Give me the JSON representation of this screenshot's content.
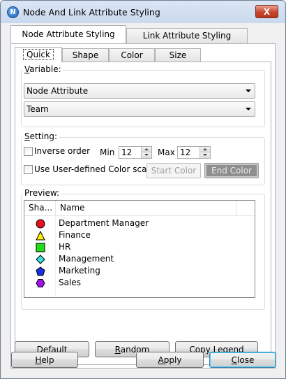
{
  "window": {
    "title": "Node And Link Attribute Styling",
    "close_glyph": "X",
    "app_icon_letter": "N"
  },
  "outer_tabs": [
    {
      "label": "Node Attribute Styling",
      "active": true
    },
    {
      "label": "Link Attribute Styling",
      "active": false
    }
  ],
  "inner_tabs": [
    {
      "label": "Quick",
      "active": true
    },
    {
      "label": "Shape",
      "active": false
    },
    {
      "label": "Color",
      "active": false
    },
    {
      "label": "Size",
      "active": false
    }
  ],
  "variable": {
    "group_label_first": "V",
    "group_label_rest": "ariable:",
    "attribute_type": "Node Attribute",
    "attribute_name": "Team"
  },
  "setting": {
    "group_label_first": "S",
    "group_label_rest": "etting:",
    "inverse_order_label": "Inverse order",
    "inverse_order_checked": false,
    "min_label": "Min",
    "min_value": "12",
    "max_label": "Max",
    "max_value": "12",
    "user_color_label": "Use User-defined Color scale",
    "user_color_checked": false,
    "start_color_label": "Start Color",
    "end_color_label": "End Color"
  },
  "preview": {
    "group_label": "Preview:",
    "columns": [
      "Sha...",
      "Name"
    ],
    "rows": [
      {
        "shape": "circle",
        "color": "#e8101c",
        "name": "Department Manager"
      },
      {
        "shape": "triangle",
        "color": "#ffee00",
        "name": "Finance"
      },
      {
        "shape": "square",
        "color": "#22dd1a",
        "name": "HR"
      },
      {
        "shape": "diamond",
        "color": "#36e0e0",
        "name": "Management"
      },
      {
        "shape": "pentagon",
        "color": "#1432e0",
        "name": "Marketing"
      },
      {
        "shape": "hexagon",
        "color": "#a010e8",
        "name": "Sales"
      }
    ]
  },
  "panel_buttons": {
    "default_first": "D",
    "default_rest": "efault",
    "random_first": "R",
    "random_rest": "andom",
    "copy_legend_first": "Copy ",
    "copy_legend_u": "L",
    "copy_legend_rest": "egend"
  },
  "dialog_buttons": {
    "help_first": "H",
    "help_rest": "elp",
    "apply_first": "A",
    "apply_rest": "pply",
    "close_first": "C",
    "close_rest": "lose"
  }
}
